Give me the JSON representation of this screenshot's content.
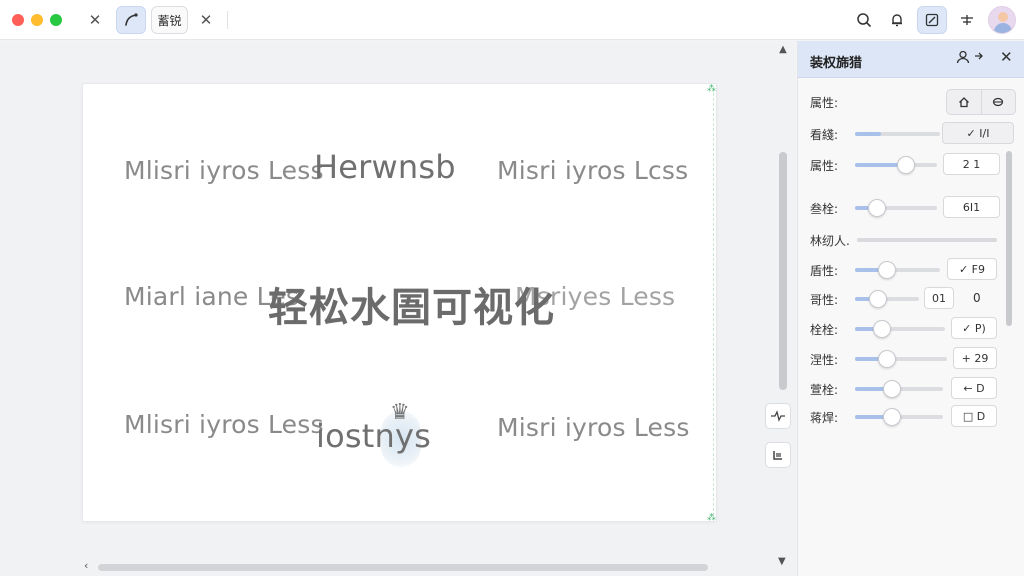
{
  "titlebar": {
    "tab_label": "蓄锐",
    "icons": [
      "close-icon",
      "curve-tool-icon",
      "close-icon",
      "search-icon",
      "bell-icon",
      "edit-icon",
      "tree-icon",
      "avatar"
    ]
  },
  "canvas": {
    "watermark_center": "轻松水圄可视化",
    "tiles": [
      {
        "text": "Mlisri iyros Less"
      },
      {
        "text": "Herwnsb"
      },
      {
        "text": "Misri iyros Lcss"
      },
      {
        "text": "Miarl iane Les"
      },
      {
        "text": "Msriyes Less"
      },
      {
        "text": "Mlisri iyros Less"
      },
      {
        "text": "iostnys"
      },
      {
        "text": "Misri iyros Less"
      }
    ]
  },
  "panel": {
    "title": "装权旆猎",
    "rows": [
      {
        "label": "属性:",
        "type": "segmented"
      },
      {
        "label": "看綫:",
        "value": "✓  I/I",
        "percent": 0.3
      },
      {
        "label": "属性:",
        "value": "2 1",
        "percent": 0.62
      },
      {
        "label": "叁栓:",
        "value": "6I1",
        "percent": 0.27
      },
      {
        "label": "林纫人.",
        "type": "plain",
        "percent": 0.0
      },
      {
        "label": "盾性:",
        "value": "✓  F9",
        "percent": 0.37
      },
      {
        "label": "哥性:",
        "value": "01",
        "extra": "0",
        "percent": 0.39
      },
      {
        "label": "栓栓:",
        "value": "✓  P)",
        "percent": 0.31
      },
      {
        "label": "涅性:",
        "value": "+  29",
        "percent": 0.38
      },
      {
        "label": "萱栓:",
        "value": "←  D",
        "percent": 0.42
      },
      {
        "label": "蒋焊:",
        "value": "□  D",
        "percent": 0.42
      }
    ]
  },
  "colors": {
    "accent": "#a9c1ea",
    "panel_header": "#dce6f6",
    "active_tool": "#dde7f8"
  }
}
